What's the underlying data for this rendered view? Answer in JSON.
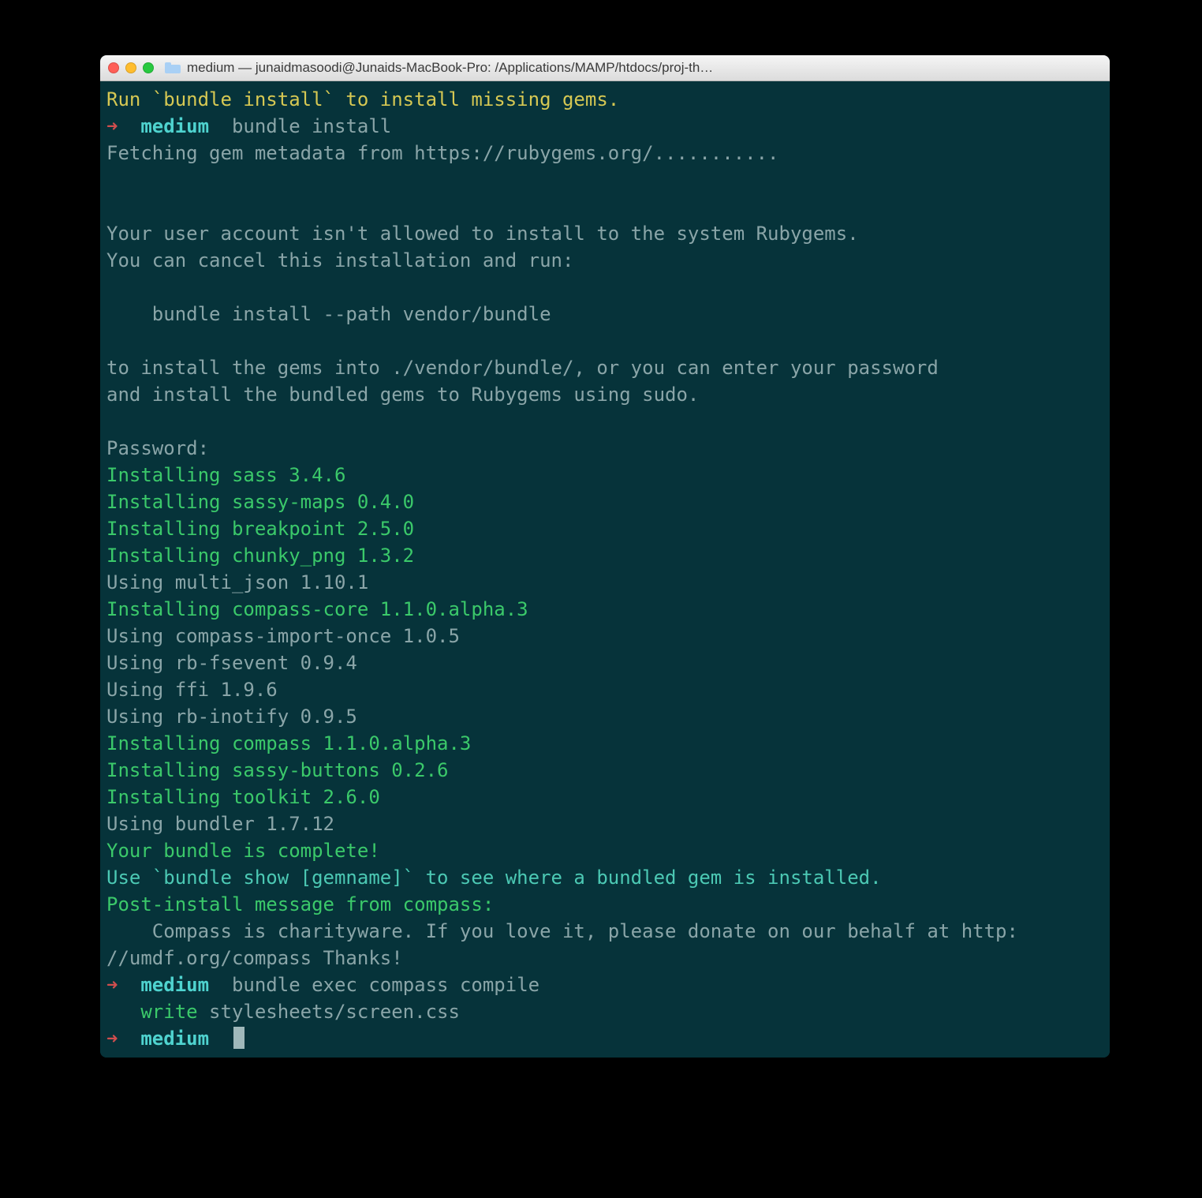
{
  "window": {
    "title": "medium — junaidmasoodi@Junaids-MacBook-Pro: /Applications/MAMP/htdocs/proj-th…"
  },
  "terminal": {
    "lines": [
      {
        "segments": [
          {
            "text": "Run `bundle install` to install missing gems.",
            "cls": "c-yellow"
          }
        ]
      },
      {
        "segments": [
          {
            "text": "➜  ",
            "cls": "c-arrow"
          },
          {
            "text": "medium",
            "cls": "c-dir"
          },
          {
            "text": "  bundle install",
            "cls": "c-muted"
          }
        ]
      },
      {
        "segments": [
          {
            "text": "Fetching gem metadata from https://rubygems.org/...........",
            "cls": "c-muted"
          }
        ]
      },
      {
        "segments": [
          {
            "text": " ",
            "cls": "c-muted"
          }
        ]
      },
      {
        "segments": [
          {
            "text": " ",
            "cls": "c-muted"
          }
        ]
      },
      {
        "segments": [
          {
            "text": "Your user account isn't allowed to install to the system Rubygems.",
            "cls": "c-muted"
          }
        ]
      },
      {
        "segments": [
          {
            "text": "You can cancel this installation and run:",
            "cls": "c-muted"
          }
        ]
      },
      {
        "segments": [
          {
            "text": " ",
            "cls": "c-muted"
          }
        ]
      },
      {
        "segments": [
          {
            "text": "    bundle install --path vendor/bundle",
            "cls": "c-muted"
          }
        ]
      },
      {
        "segments": [
          {
            "text": " ",
            "cls": "c-muted"
          }
        ]
      },
      {
        "segments": [
          {
            "text": "to install the gems into ./vendor/bundle/, or you can enter your password",
            "cls": "c-muted"
          }
        ]
      },
      {
        "segments": [
          {
            "text": "and install the bundled gems to Rubygems using sudo.",
            "cls": "c-muted"
          }
        ]
      },
      {
        "segments": [
          {
            "text": " ",
            "cls": "c-muted"
          }
        ]
      },
      {
        "segments": [
          {
            "text": "Password:",
            "cls": "c-muted"
          }
        ]
      },
      {
        "segments": [
          {
            "text": "Installing sass 3.4.6",
            "cls": "c-green"
          }
        ]
      },
      {
        "segments": [
          {
            "text": "Installing sassy-maps 0.4.0",
            "cls": "c-green"
          }
        ]
      },
      {
        "segments": [
          {
            "text": "Installing breakpoint 2.5.0",
            "cls": "c-green"
          }
        ]
      },
      {
        "segments": [
          {
            "text": "Installing chunky_png 1.3.2",
            "cls": "c-green"
          }
        ]
      },
      {
        "segments": [
          {
            "text": "Using multi_json 1.10.1",
            "cls": "c-muted"
          }
        ]
      },
      {
        "segments": [
          {
            "text": "Installing compass-core 1.1.0.alpha.3",
            "cls": "c-green"
          }
        ]
      },
      {
        "segments": [
          {
            "text": "Using compass-import-once 1.0.5",
            "cls": "c-muted"
          }
        ]
      },
      {
        "segments": [
          {
            "text": "Using rb-fsevent 0.9.4",
            "cls": "c-muted"
          }
        ]
      },
      {
        "segments": [
          {
            "text": "Using ffi 1.9.6",
            "cls": "c-muted"
          }
        ]
      },
      {
        "segments": [
          {
            "text": "Using rb-inotify 0.9.5",
            "cls": "c-muted"
          }
        ]
      },
      {
        "segments": [
          {
            "text": "Installing compass 1.1.0.alpha.3",
            "cls": "c-green"
          }
        ]
      },
      {
        "segments": [
          {
            "text": "Installing sassy-buttons 0.2.6",
            "cls": "c-green"
          }
        ]
      },
      {
        "segments": [
          {
            "text": "Installing toolkit 2.6.0",
            "cls": "c-green"
          }
        ]
      },
      {
        "segments": [
          {
            "text": "Using bundler 1.7.12",
            "cls": "c-muted"
          }
        ]
      },
      {
        "segments": [
          {
            "text": "Your bundle is complete!",
            "cls": "c-green"
          }
        ]
      },
      {
        "segments": [
          {
            "text": "Use `bundle show [gemname]` to see where a bundled gem is installed.",
            "cls": "c-cyan"
          }
        ]
      },
      {
        "segments": [
          {
            "text": "Post-install message from compass:",
            "cls": "c-green"
          }
        ]
      },
      {
        "segments": [
          {
            "text": "    Compass is charityware. If you love it, please donate on our behalf at http:",
            "cls": "c-muted"
          }
        ]
      },
      {
        "segments": [
          {
            "text": "//umdf.org/compass Thanks!",
            "cls": "c-muted"
          }
        ]
      },
      {
        "segments": [
          {
            "text": "➜  ",
            "cls": "c-arrow"
          },
          {
            "text": "medium",
            "cls": "c-dir"
          },
          {
            "text": "  bundle exec compass compile",
            "cls": "c-muted"
          }
        ]
      },
      {
        "segments": [
          {
            "text": "   write",
            "cls": "c-green"
          },
          {
            "text": " stylesheets/screen.css",
            "cls": "c-muted"
          }
        ]
      },
      {
        "segments": [
          {
            "text": "➜  ",
            "cls": "c-arrow"
          },
          {
            "text": "medium",
            "cls": "c-dir"
          },
          {
            "text": "  ",
            "cls": "c-muted"
          }
        ],
        "cursor": true
      }
    ]
  }
}
